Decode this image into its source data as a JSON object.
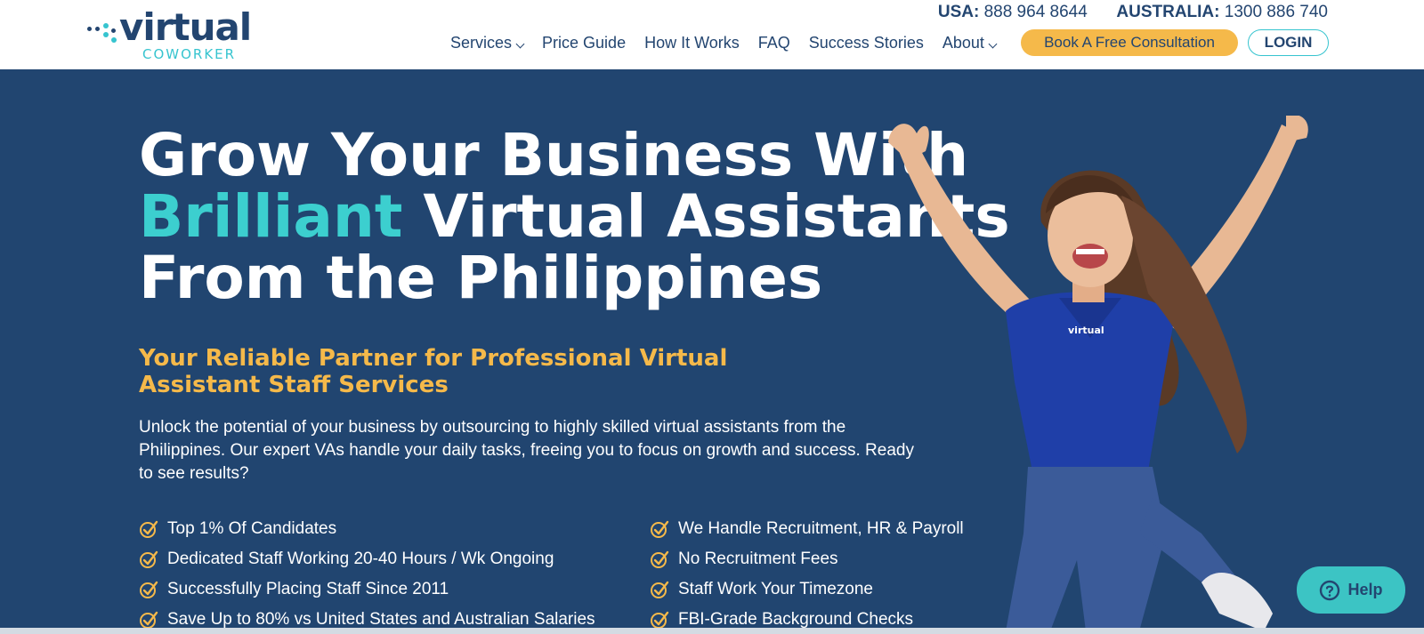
{
  "header": {
    "logo": {
      "word": "virtual",
      "sub": "COWORKER"
    },
    "phones": {
      "usa_label": "USA:",
      "usa_number": "888 964 8644",
      "aus_label": "AUSTRALIA:",
      "aus_number": "1300 886 740"
    },
    "nav": {
      "services": "Services",
      "price_guide": "Price Guide",
      "how_it_works": "How It Works",
      "faq": "FAQ",
      "success_stories": "Success Stories",
      "about": "About"
    },
    "consult_button": "Book A Free Consultation",
    "login_button": "LOGIN"
  },
  "hero": {
    "headline_line1": "Grow Your Business With",
    "headline_accent": "Brilliant",
    "headline_line2_rest": " Virtual Assistants",
    "headline_line3": "From the Philippines",
    "subheading": "Your Reliable Partner for Professional Virtual Assistant Staff Services",
    "intro": "Unlock the potential of your business by outsourcing to highly skilled virtual assistants from the Philippines. Our expert VAs handle your daily tasks, freeing you to focus on growth and success. Ready to see results?",
    "features_left": [
      "Top 1% Of Candidates",
      "Dedicated Staff Working 20-40 Hours / Wk Ongoing",
      "Successfully Placing Staff Since 2011",
      "Save Up to 80% vs United States and Australian Salaries"
    ],
    "features_right": [
      "We Handle Recruitment, HR & Payroll",
      "No Recruitment Fees",
      "Staff Work Your Timezone",
      "FBI-Grade Background Checks"
    ]
  },
  "help_button": "Help",
  "colors": {
    "navy": "#214570",
    "teal": "#3ccfcf",
    "gold": "#f5b94a",
    "white": "#ffffff"
  },
  "icons": {
    "check": "check-circle-icon",
    "help": "question-circle-icon",
    "chevron": "chevron-down-icon"
  }
}
